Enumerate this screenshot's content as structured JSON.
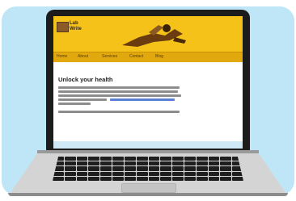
{
  "site": {
    "brand": "Lab Write",
    "nav": [
      "Home",
      "About",
      "Services",
      "Contact",
      "Blog"
    ]
  },
  "page": {
    "heading": "Unlock your health"
  },
  "colors": {
    "background_card": "#bfe6f6",
    "header": "#f5c21a",
    "nav": "#e2a90f",
    "link": "#5b7fd2"
  },
  "icons": {
    "logo": "logo-icon",
    "hero": "hero-illustration"
  }
}
